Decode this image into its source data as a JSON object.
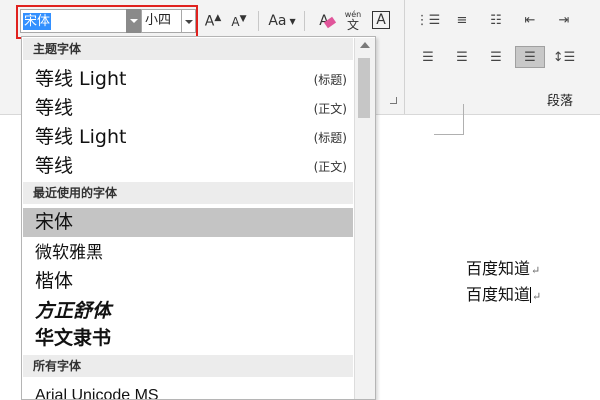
{
  "toolbar": {
    "font_name": "宋体",
    "font_size": "小四",
    "grow_font_label": "A",
    "shrink_font_label": "A",
    "change_case_label": "Aa",
    "clear_format_label": "A",
    "phonetic_top": "wén",
    "phonetic_bottom": "文",
    "char_border_label": "A"
  },
  "paragraph_group": {
    "label": "段落"
  },
  "font_dropdown": {
    "theme_header": "主题字体",
    "theme_fonts": [
      {
        "name": "等线 Light",
        "tag": "(标题)"
      },
      {
        "name": "等线",
        "tag": "(正文)"
      },
      {
        "name": "等线 Light",
        "tag": "(标题)"
      },
      {
        "name": "等线",
        "tag": "(正文)"
      }
    ],
    "recent_header": "最近使用的字体",
    "recent_fonts": [
      "宋体",
      "微软雅黑",
      "楷体",
      "方正舒体",
      "华文隶书"
    ],
    "all_header": "所有字体",
    "all_fonts": [
      "Arial Unicode MS"
    ]
  },
  "document": {
    "lines": [
      "百度知道",
      "百度知道"
    ]
  },
  "colors": {
    "highlight_border": "#e0211e",
    "selection_blue": "#3390ff",
    "selected_item_bg": "#c4c4c4"
  }
}
